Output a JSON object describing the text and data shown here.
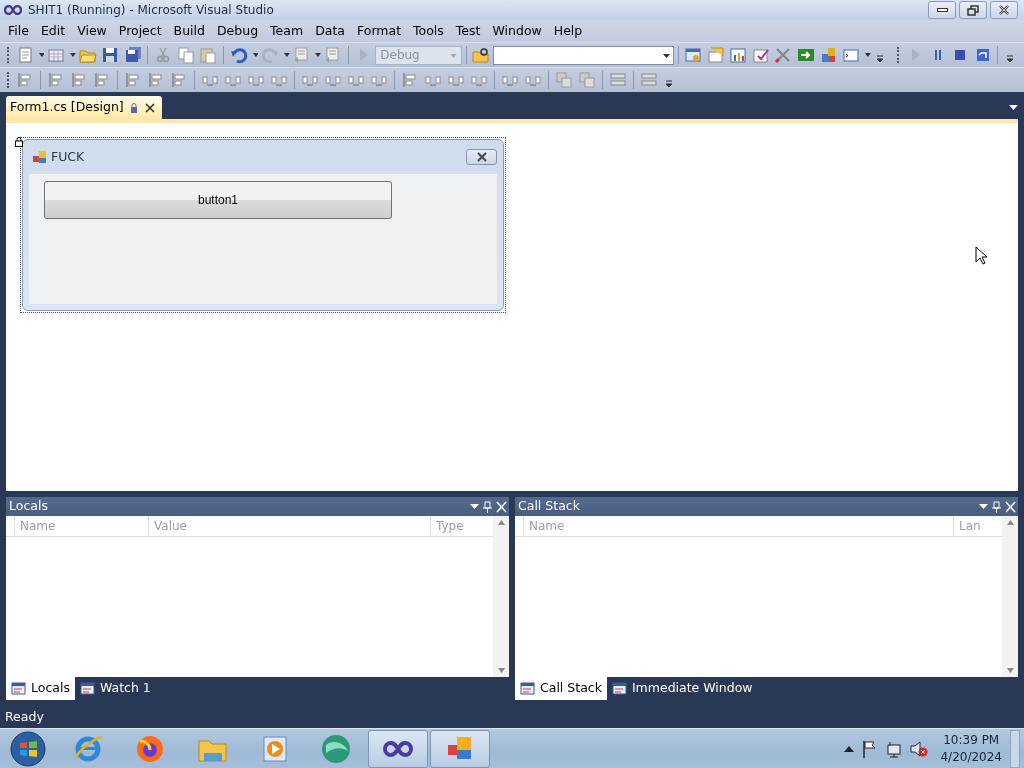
{
  "window": {
    "title": "SHIT1 (Running) - Microsoft Visual Studio"
  },
  "menu": [
    "File",
    "Edit",
    "View",
    "Project",
    "Build",
    "Debug",
    "Team",
    "Data",
    "Format",
    "Tools",
    "Test",
    "Window",
    "Help"
  ],
  "toolbar": {
    "configuration": {
      "value": "Debug",
      "disabled": true
    }
  },
  "document_tabs": [
    {
      "label": "Form1.cs [Design]",
      "selected": true
    }
  ],
  "form": {
    "title": "FUCK",
    "button": "button1"
  },
  "panels": [
    {
      "title": "Locals",
      "columns": [
        "Name",
        "Value",
        "Type"
      ],
      "tabs": [
        {
          "label": "Locals",
          "selected": true
        },
        {
          "label": "Watch 1",
          "selected": false
        }
      ]
    },
    {
      "title": "Call Stack",
      "columns": [
        "Name",
        "Lan"
      ],
      "tabs": [
        {
          "label": "Call Stack",
          "selected": true
        },
        {
          "label": "Immediate Window",
          "selected": false
        }
      ]
    }
  ],
  "status_bar": "Ready",
  "taskbar": {
    "apps": [
      {
        "kind": "browser-e",
        "running": false
      },
      {
        "kind": "fox",
        "running": false
      },
      {
        "kind": "folder",
        "running": false
      },
      {
        "kind": "media",
        "running": false
      },
      {
        "kind": "sphere",
        "running": false
      },
      {
        "kind": "infinity",
        "running": true
      },
      {
        "kind": "form",
        "running": true
      }
    ],
    "time": "10:39 PM",
    "date": "4/20/2024"
  }
}
